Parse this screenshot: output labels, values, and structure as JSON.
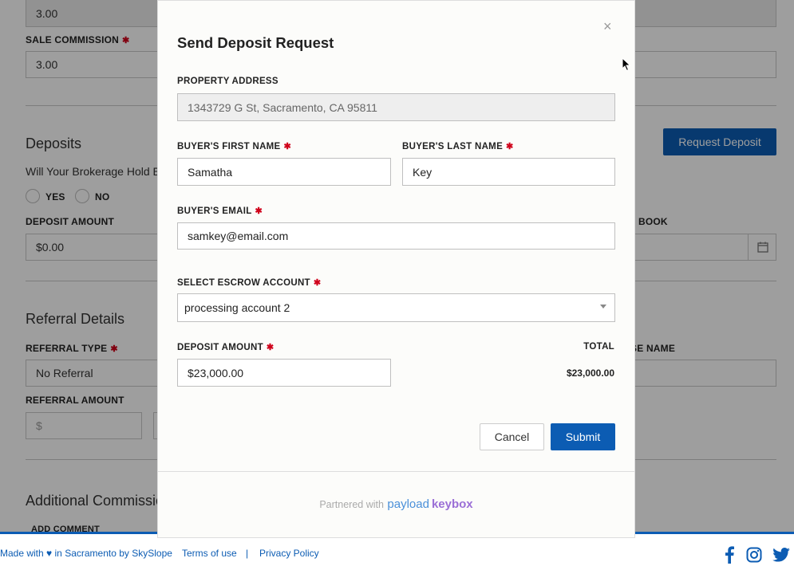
{
  "background": {
    "top_field_value": "3.00",
    "sale_commission_label": "SALE COMMISSION",
    "sale_commission_value": "3.00",
    "deposits_title": "Deposits",
    "request_deposit_button": "Request Deposit",
    "brokerage_question": "Will Your Brokerage Hold Ea",
    "yes_label": "YES",
    "no_label": "NO",
    "deposit_amount_label": "DEPOSIT AMOUNT",
    "deposit_amount_value": "$0.00",
    "book_label": "BOOK",
    "referral_title": "Referral Details",
    "referral_type_label": "REFERRAL TYPE",
    "referral_type_value": "No Referral",
    "referral_amount_label": "REFERRAL AMOUNT",
    "referral_amount_placeholder": "$",
    "se_name_label": "SE NAME",
    "additional_title": "Additional Commissio",
    "add_comment_label": "ADD COMMENT"
  },
  "footer": {
    "made_with_prefix": "Made with",
    "made_with_suffix": "in Sacramento by SkySlope",
    "terms": "Terms of use",
    "separator": "|",
    "privacy": "Privacy Policy",
    "accent_color": "#0c5cb3"
  },
  "modal": {
    "title": "Send Deposit Request",
    "close_glyph": "×",
    "property_address_label": "PROPERTY ADDRESS",
    "property_address_value": "1343729 G St, Sacramento, CA 95811",
    "first_name_label": "BUYER'S FIRST NAME",
    "first_name_value": "Samatha",
    "last_name_label": "BUYER'S LAST NAME",
    "last_name_value": "Key",
    "email_label": "BUYER'S EMAIL",
    "email_value": "samkey@email.com",
    "escrow_label": "SELECT ESCROW ACCOUNT",
    "escrow_value": "processing account 2",
    "deposit_label": "DEPOSIT AMOUNT",
    "deposit_value": "$23,000.00",
    "total_label": "TOTAL",
    "total_value": "$23,000.00",
    "cancel_label": "Cancel",
    "submit_label": "Submit",
    "partnered_text": "Partnered with",
    "payload_text": "payload",
    "keybox_text": "keybox",
    "required_mark": "✱"
  }
}
